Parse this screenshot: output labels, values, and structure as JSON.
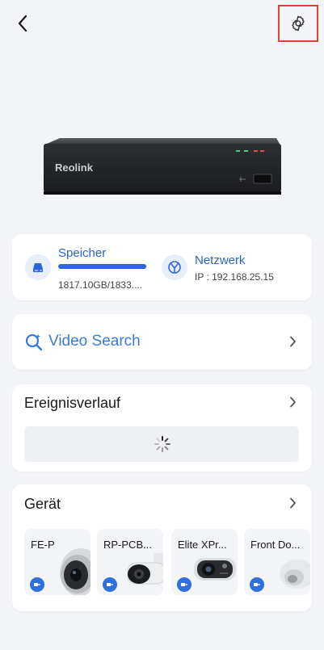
{
  "header": {
    "back_icon": "chevron-left-icon",
    "settings_icon": "gear-icon"
  },
  "nvr": {
    "brand": "Reolink"
  },
  "status": {
    "storage": {
      "title": "Speicher",
      "value": "1817.10GB/1833....",
      "usage_fraction": 0.99,
      "icon": "storage-drive-icon"
    },
    "network": {
      "title": "Netzwerk",
      "value": "IP : 192.168.25.15",
      "icon": "network-icon"
    }
  },
  "video_search": {
    "label": "Video Search",
    "icon": "sparkle-search-icon"
  },
  "events": {
    "title": "Ereignisverlauf"
  },
  "devices": {
    "title": "Gerät",
    "items": [
      {
        "name": "FE-P",
        "icon": "camera-icon"
      },
      {
        "name": "RP-PCB...",
        "icon": "camera-icon"
      },
      {
        "name": "Elite XPr...",
        "icon": "camera-icon"
      },
      {
        "name": "Front Do...",
        "icon": "camera-icon"
      }
    ]
  },
  "colors": {
    "accent": "#2e66d9",
    "background": "#f3f4f8",
    "highlight_border": "#e0413c"
  }
}
